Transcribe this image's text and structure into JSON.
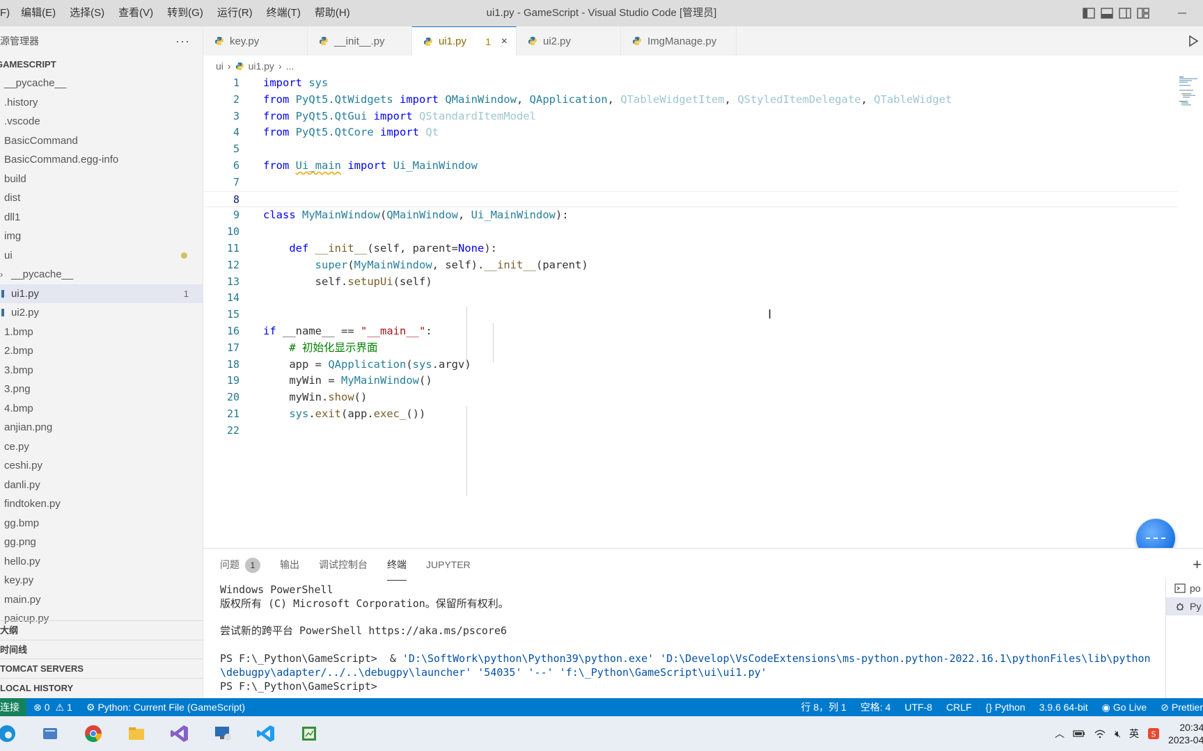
{
  "titlebar": {
    "menu": [
      "F)",
      "编辑(E)",
      "选择(S)",
      "查看(V)",
      "转到(G)",
      "运行(R)",
      "终端(T)",
      "帮助(H)"
    ],
    "window_title": "ui1.py - GameScript - Visual Studio Code [管理员]",
    "icons": [
      "layout-sidebar-left-icon",
      "layout-panel-icon",
      "layout-sidebar-right-icon",
      "customize-layout-icon",
      "minimize-icon"
    ]
  },
  "sidebar": {
    "header": "资源管理器",
    "more": "···",
    "root": "GAMESCRIPT",
    "items": [
      {
        "label": "__pycache__"
      },
      {
        "label": ".history"
      },
      {
        "label": ".vscode"
      },
      {
        "label": "BasicCommand"
      },
      {
        "label": "BasicCommand.egg-info"
      },
      {
        "label": "build"
      },
      {
        "label": "dist"
      },
      {
        "label": "dll1"
      },
      {
        "label": "img"
      },
      {
        "label": "ui"
      },
      {
        "label": "__pycache__"
      },
      {
        "label": "ui1.py",
        "badge": "1"
      },
      {
        "label": "ui2.py"
      },
      {
        "label": "1.bmp"
      },
      {
        "label": "2.bmp"
      },
      {
        "label": "3.bmp"
      },
      {
        "label": "3.png"
      },
      {
        "label": "4.bmp"
      },
      {
        "label": "anjian.png"
      },
      {
        "label": "ce.py"
      },
      {
        "label": "ceshi.py"
      },
      {
        "label": "danli.py"
      },
      {
        "label": "findtoken.py"
      },
      {
        "label": "gg.bmp"
      },
      {
        "label": "gg.png"
      },
      {
        "label": "hello.py"
      },
      {
        "label": "key.py"
      },
      {
        "label": "main.py"
      },
      {
        "label": "paicup.py"
      }
    ],
    "bottom_sections": [
      "大纲",
      "时间线",
      "TOMCAT SERVERS",
      "LOCAL HISTORY"
    ]
  },
  "tabs": [
    {
      "label": "key.py"
    },
    {
      "label": "__init__.py"
    },
    {
      "label": "ui1.py",
      "badge": "1",
      "close": "×"
    },
    {
      "label": "ui2.py"
    },
    {
      "label": "ImgManage.py"
    }
  ],
  "breadcrumb": {
    "folder": "ui",
    "file": "ui1.py",
    "rest": "..."
  },
  "editor": {
    "line_numbers": [
      "1",
      "2",
      "3",
      "4",
      "5",
      "6",
      "7",
      "8",
      "9",
      "10",
      "11",
      "12",
      "13",
      "14",
      "15",
      "16",
      "17",
      "18",
      "19",
      "20",
      "21",
      "22"
    ],
    "tokens": {
      "import": "import",
      "from": "from",
      "class": "class",
      "def": "def",
      "if": "if",
      "sys": "sys",
      "pyqt_widgets": "PyQt5.QtWidgets",
      "pyqt_gui": "PyQt5.QtGui",
      "pyqt_core": "PyQt5.QtCore",
      "qmainwindow": "QMainWindow",
      "qapplication": "QApplication",
      "qtablewidgetitem": "QTableWidgetItem",
      "qstyleditemdelegate": "QStyledItemDelegate",
      "qtablewidget": "QTableWidget",
      "qstandarditemmodel": "QStandardItemModel",
      "qt": "Qt",
      "ui_main": "Ui_main",
      "ui_mainwindow": "Ui_MainWindow",
      "mymainwindow": "MyMainWindow",
      "init": "__init__",
      "self": "self",
      "parent": "parent",
      "none": "None",
      "super": "super",
      "setupui": "setupUi",
      "name": "__name__",
      "main_str": "\"__main__\"",
      "comment": "# 初始化显示界面",
      "app": "app",
      "argv": "argv",
      "mywin": "myWin",
      "show": "show",
      "exit": "exit",
      "exec": "exec_"
    }
  },
  "panel": {
    "tabs": [
      {
        "label": "问题",
        "badge": "1"
      },
      {
        "label": "输出"
      },
      {
        "label": "调试控制台"
      },
      {
        "label": "终端",
        "active": true
      },
      {
        "label": "JUPYTER"
      }
    ],
    "plus": "+",
    "terminal": {
      "l1": "Windows PowerShell",
      "l2": "版权所有 (C) Microsoft Corporation。保留所有权利。",
      "l3": "尝试新的跨平台 PowerShell https://aka.ms/pscore6",
      "prompt": "PS F:\\_Python\\GameScript>",
      "cmd_amp": "&",
      "arg_python": "'D:\\SoftWork\\python\\Python39\\python.exe'",
      "arg_debugpy1": "'D:\\Develop\\VsCodeExtensions\\ms-python.python-2022.16.1\\pythonFiles\\lib\\python",
      "arg_debugpy2": "\\debugpy\\adapter/../..\\debugpy\\launcher'",
      "arg_port": "'54035'",
      "arg_sep": "'--'",
      "arg_file": "'f:\\_Python\\GameScript\\ui\\ui1.py'"
    },
    "side": [
      {
        "label": "po",
        "icon": "terminal-icon"
      },
      {
        "label": "Py",
        "icon": "debug-icon"
      }
    ]
  },
  "statusbar": {
    "remote": "连接",
    "errors": "0",
    "warnings": "1",
    "run_config": "Python: Current File (GameScript)",
    "position": "行 8，列 1",
    "spaces": "空格: 4",
    "encoding": "UTF-8",
    "eol": "CRLF",
    "language": "Python",
    "interpreter": "3.9.6 64-bit",
    "golive": "Go Live",
    "prettier": "Prettier"
  },
  "taskbar": {
    "apps": [
      "edge-icon",
      "notes-icon",
      "chrome-icon",
      "file-explorer-icon",
      "visual-studio-icon",
      "remote-desktop-icon",
      "vscode-icon",
      "spreadsheet-icon"
    ],
    "tray_lang": "英",
    "time": "20:34",
    "date": "2023-04"
  },
  "colors": {
    "accent": "#007acc",
    "keyword": "#0000ff",
    "class": "#267f99",
    "function": "#795e26",
    "string": "#a31515",
    "comment": "#008000"
  }
}
